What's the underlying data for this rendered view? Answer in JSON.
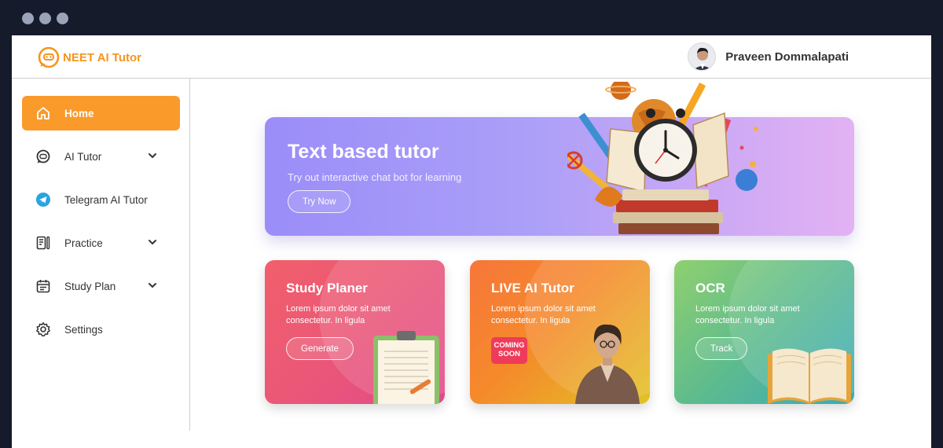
{
  "app": {
    "brand": "NEET AI Tutor",
    "accent": "#f7941d"
  },
  "user": {
    "name": "Praveen Dommalapati"
  },
  "sidebar": {
    "items": [
      {
        "label": "Home",
        "icon": "home-icon",
        "active": true
      },
      {
        "label": "AI Tutor",
        "icon": "chat-bot-icon",
        "expandable": true
      },
      {
        "label": "Telegram AI Tutor",
        "icon": "telegram-icon"
      },
      {
        "label": "Practice",
        "icon": "practice-icon",
        "expandable": true
      },
      {
        "label": "Study Plan",
        "icon": "calendar-icon",
        "expandable": true
      },
      {
        "label": "Settings",
        "icon": "gear-icon"
      }
    ]
  },
  "hero": {
    "title": "Text based tutor",
    "subtitle": "Try out interactive chat bot for learning",
    "button": "Try Now"
  },
  "cards": [
    {
      "title": "Study Planer",
      "subtitle": "Lorem ipsum dolor sit amet consectetur. In ligula",
      "button": "Generate"
    },
    {
      "title": "LIVE AI Tutor",
      "subtitle": "Lorem ipsum dolor sit amet consectetur. In ligula",
      "badge": "COMING SOON"
    },
    {
      "title": "OCR",
      "subtitle": "Lorem ipsum dolor sit amet consectetur. In ligula",
      "button": "Track"
    }
  ]
}
